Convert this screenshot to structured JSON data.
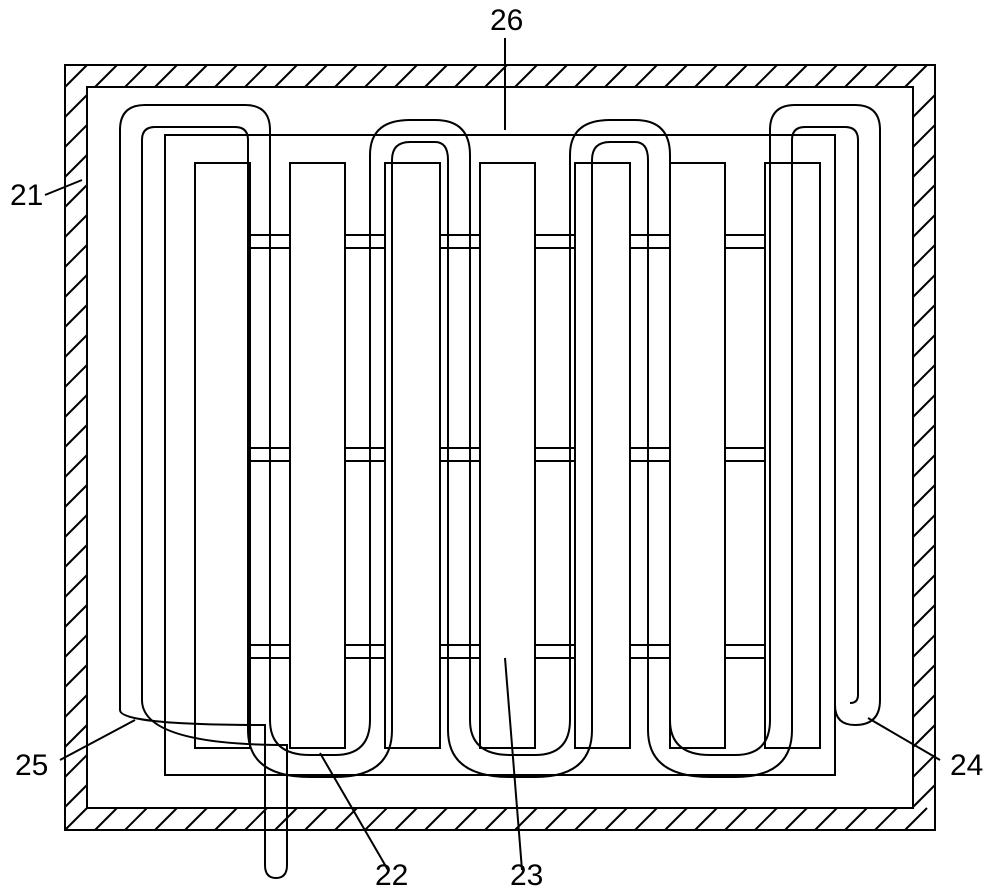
{
  "labels": {
    "top_center": "26",
    "left": "21",
    "bottom_right": "24",
    "bottom_left": "25",
    "bottom_inner_left": "22",
    "bottom_inner_right": "23"
  }
}
